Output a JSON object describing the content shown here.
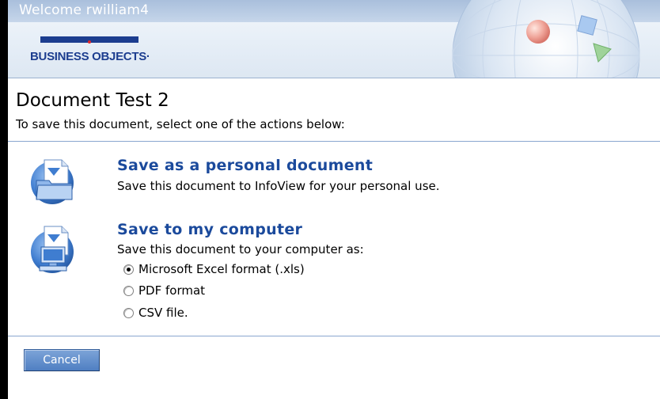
{
  "header": {
    "welcome": "Welcome rwilliam4",
    "logo_text": "BUSINESS OBJECTS·"
  },
  "document": {
    "title": "Document Test 2",
    "instruction": "To save this document, select one of the actions below:"
  },
  "options": [
    {
      "title": "Save as a personal document",
      "description": "Save this document to InfoView for your personal use.",
      "icon": "folder-save-icon"
    },
    {
      "title": "Save to my computer",
      "description": "Save this document to your computer as:",
      "icon": "computer-save-icon"
    }
  ],
  "formats": [
    {
      "label": "Microsoft Excel format (.xls)",
      "selected": true
    },
    {
      "label": "PDF format",
      "selected": false
    },
    {
      "label": "CSV file.",
      "selected": false
    }
  ],
  "cancel_label": "Cancel",
  "colors": {
    "link_blue": "#1b4a9c",
    "brand_navy": "#1c3d8f",
    "divider": "#8aa6cf",
    "button": "#5b89c8"
  }
}
